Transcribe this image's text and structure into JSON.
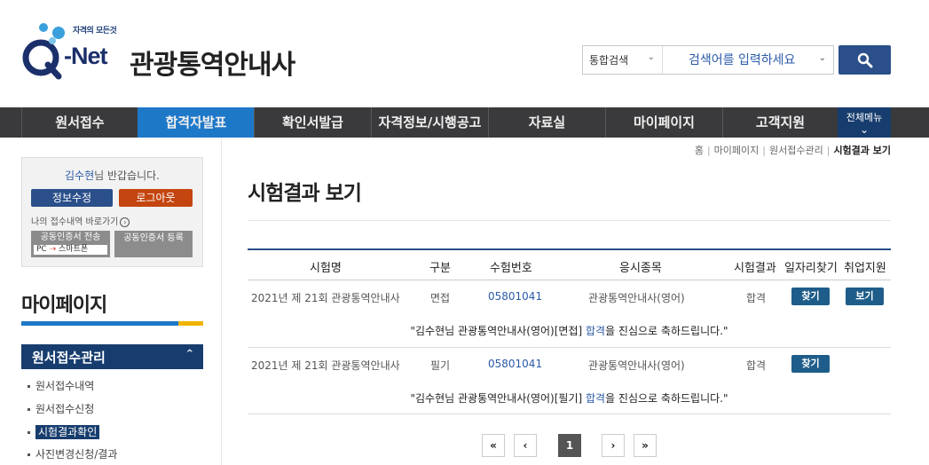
{
  "header": {
    "logo_tagline": "자격의 모든것",
    "logo_net": "-Net",
    "site_title": "관광통역안내사",
    "search_scope": "통합검색",
    "search_placeholder": "검색어를 입력하세요"
  },
  "nav": {
    "items": [
      {
        "label": "원서접수"
      },
      {
        "label": "합격자발표"
      },
      {
        "label": "확인서발급"
      },
      {
        "label": "자격정보/시행공고"
      },
      {
        "label": "자료실"
      },
      {
        "label": "마이페이지"
      },
      {
        "label": "고객지원"
      }
    ],
    "all_menu": "전체메뉴"
  },
  "sidebar": {
    "user_name": "김수현",
    "welcome_suffix": "님 반갑습니다.",
    "edit_btn": "정보수정",
    "logout_btn": "로그아웃",
    "quick_link": "나의 접수내역 바로가기",
    "cert_send_l1": "공동인증서 전송",
    "cert_send_pc": "PC",
    "cert_send_phone": "스마트폰",
    "cert_reg": "공동인증서 등록",
    "title": "마이페이지",
    "menu_head": "원서접수관리",
    "sub_items": [
      {
        "label": "원서접수내역"
      },
      {
        "label": "원서접수신청"
      },
      {
        "label": "시험결과확인"
      },
      {
        "label": "사진변경신청/결과"
      }
    ]
  },
  "breadcrumb": [
    "홈",
    "마이페이지",
    "원서접수관리",
    "시험결과 보기"
  ],
  "main": {
    "title": "시험결과 보기",
    "columns": [
      "시험명",
      "구분",
      "수험번호",
      "응시종목",
      "시험결과",
      "일자리찾기",
      "취업지원"
    ],
    "rows": [
      {
        "exam": "2021년 제 21회 관광통역안내사",
        "type": "면접",
        "number": "05801041",
        "subject": "관광통역안내사(영어)",
        "result": "합격",
        "job_btn": "찾기",
        "support_btn": "보기",
        "msg_pre": "\"김수현님 관광통역안내사(영어)[면접] ",
        "msg_hl": "합격",
        "msg_post": "을 진심으로 축하드립니다.\""
      },
      {
        "exam": "2021년 제 21회 관광통역안내사",
        "type": "필기",
        "number": "05801041",
        "subject": "관광통역안내사(영어)",
        "result": "합격",
        "job_btn": "찾기",
        "msg_pre": "\"김수현님 관광통역안내사(영어)[필기] ",
        "msg_hl": "합격",
        "msg_post": "을 진심으로 축하드립니다.\""
      }
    ]
  },
  "pagination": {
    "first": "«",
    "prev": "‹",
    "current": "1",
    "next": "›",
    "last": "»"
  }
}
